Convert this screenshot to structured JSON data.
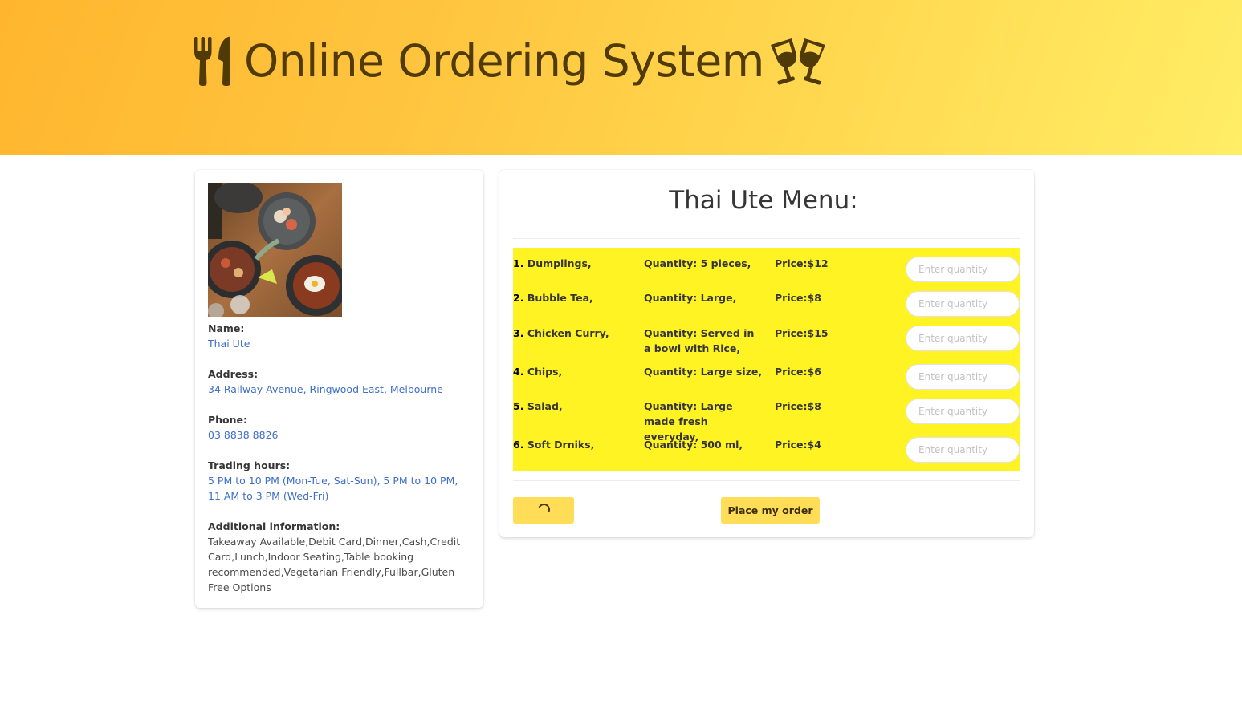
{
  "header": {
    "title": "Online Ordering System",
    "left_icon": "utensils-icon",
    "right_icon": "glasses-cheers-icon",
    "gradient_colors": [
      "#ffb62e",
      "#ffee66"
    ]
  },
  "restaurant": {
    "image": "food-photo",
    "name_label": "Name:",
    "name": "Thai Ute",
    "address_label": "Address:",
    "address": "34 Railway Avenue, Ringwood East, Melbourne",
    "phone_label": "Phone:",
    "phone": "03 8838 8826",
    "hours_label": "Trading hours:",
    "hours": "5 PM to 10 PM (Mon-Tue, Sat-Sun), 5 PM to 10 PM, 11 AM to 3 PM (Wed-Fri)",
    "info_label": "Additional information:",
    "info": "Takeaway Available,Debit Card,Dinner,Cash,Credit Card,Lunch,Indoor Seating,Table booking recommended,Vegetarian Friendly,Fullbar,Gluten Free Options"
  },
  "menu": {
    "title": "Thai Ute Menu:",
    "highlight_color": "#fff324",
    "items": [
      {
        "num": "1.",
        "name": "Dumplings,",
        "quantity": "Quantity: 5 pieces,",
        "price": "Price:$12",
        "input_placeholder": "Enter quantity"
      },
      {
        "num": "2.",
        "name": "Bubble Tea,",
        "quantity": "Quantity: Large,",
        "price": "Price:$8",
        "input_placeholder": "Enter quantity"
      },
      {
        "num": "3.",
        "name": "Chicken Curry,",
        "quantity": "Quantity: Served in a bowl with Rice,",
        "price": "Price:$15",
        "input_placeholder": "Enter quantity"
      },
      {
        "num": "4.",
        "name": "Chips,",
        "quantity": "Quantity: Large size,",
        "price": "Price:$6",
        "input_placeholder": "Enter quantity"
      },
      {
        "num": "5.",
        "name": "Salad,",
        "quantity": "Quantity: Large made fresh everyday,",
        "price": "Price:$8",
        "input_placeholder": "Enter quantity"
      },
      {
        "num": "6.",
        "name": "Soft Drniks,",
        "quantity": "Quantity: 500 ml,",
        "price": "Price:$4",
        "input_placeholder": "Enter quantity"
      }
    ],
    "loading_button_state": "loading",
    "order_button": "Place my order",
    "button_color": "#ffdd57"
  }
}
